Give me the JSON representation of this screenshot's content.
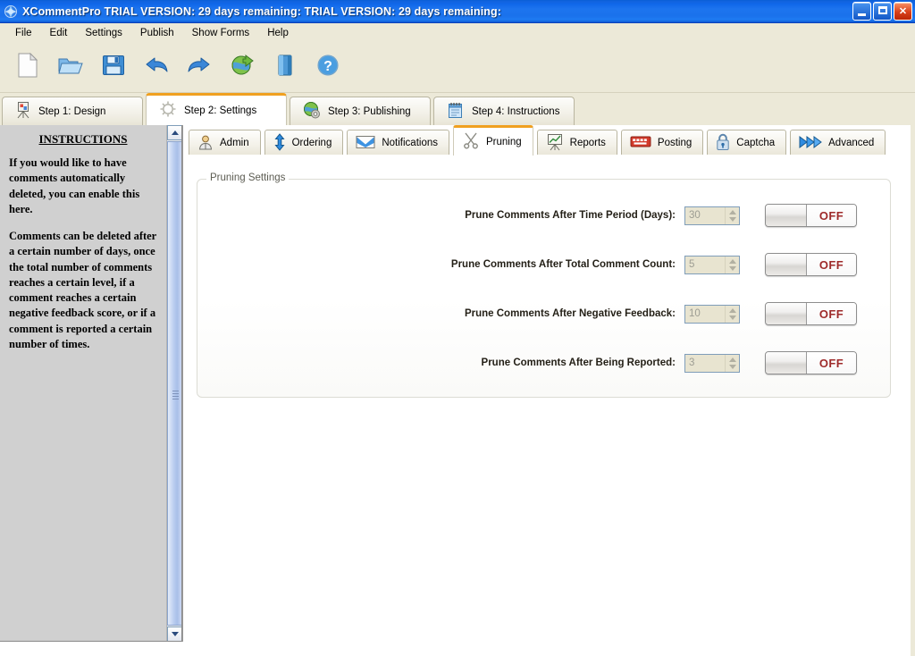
{
  "window": {
    "title": "XCommentPro TRIAL VERSION: 29 days remaining:  TRIAL VERSION: 29 days remaining:",
    "app_icon": "app-globe-icon",
    "controls": {
      "minimize": "minimize-button",
      "maximize": "maximize-button",
      "close": "close-button"
    },
    "accent_orange": "#f0a020",
    "titlebar_blue": "#1a72ec"
  },
  "menubar": {
    "items": [
      {
        "label": "File"
      },
      {
        "label": "Edit"
      },
      {
        "label": "Settings"
      },
      {
        "label": "Publish"
      },
      {
        "label": "Show Forms"
      },
      {
        "label": "Help"
      }
    ]
  },
  "toolbar": {
    "buttons": [
      {
        "icon": "new-document-icon",
        "title": "New"
      },
      {
        "icon": "open-folder-icon",
        "title": "Open"
      },
      {
        "icon": "save-floppy-icon",
        "title": "Save"
      },
      {
        "icon": "undo-arrow-icon",
        "title": "Undo"
      },
      {
        "icon": "redo-arrow-icon",
        "title": "Redo"
      },
      {
        "icon": "globe-publish-icon",
        "title": "Publish"
      },
      {
        "icon": "book-icon",
        "title": "Forms"
      },
      {
        "icon": "help-question-icon",
        "title": "Help"
      }
    ]
  },
  "step_tabs": {
    "active_index": 1,
    "items": [
      {
        "label": "Step 1: Design",
        "icon": "easel-design-icon"
      },
      {
        "label": "Step 2: Settings",
        "icon": "gear-settings-icon"
      },
      {
        "label": "Step 3: Publishing",
        "icon": "globe-publishing-icon"
      },
      {
        "label": "Step 4: Instructions",
        "icon": "notepad-instructions-icon"
      }
    ]
  },
  "sub_tabs": {
    "active_index": 3,
    "items": [
      {
        "label": "Admin",
        "icon": "user-admin-icon"
      },
      {
        "label": "Ordering",
        "icon": "updown-arrows-icon"
      },
      {
        "label": "Notifications",
        "icon": "envelope-icon"
      },
      {
        "label": "Pruning",
        "icon": "scissors-icon"
      },
      {
        "label": "Reports",
        "icon": "chart-easel-icon"
      },
      {
        "label": "Posting",
        "icon": "keyboard-icon"
      },
      {
        "label": "Captcha",
        "icon": "lock-icon"
      },
      {
        "label": "Advanced",
        "icon": "double-arrow-icon"
      }
    ]
  },
  "instructions": {
    "title": "INSTRUCTIONS",
    "paragraphs": [
      "If you would like to have comments automatically deleted, you can enable this here.",
      "Comments can be deleted after a certain number of days, once the total number of comments reaches a certain level, if a comment reaches a certain negative feedback score, or if a comment is reported a certain number of times."
    ]
  },
  "pruning_settings": {
    "legend": "Pruning Settings",
    "rows": [
      {
        "label": "Prune Comments After Time Period (Days):",
        "value": "30",
        "toggle_state": "OFF"
      },
      {
        "label": "Prune Comments After Total Comment Count:",
        "value": "5",
        "toggle_state": "OFF"
      },
      {
        "label": "Prune Comments After Negative Feedback:",
        "value": "10",
        "toggle_state": "OFF"
      },
      {
        "label": "Prune Comments After Being Reported:",
        "value": "3",
        "toggle_state": "OFF"
      }
    ]
  }
}
